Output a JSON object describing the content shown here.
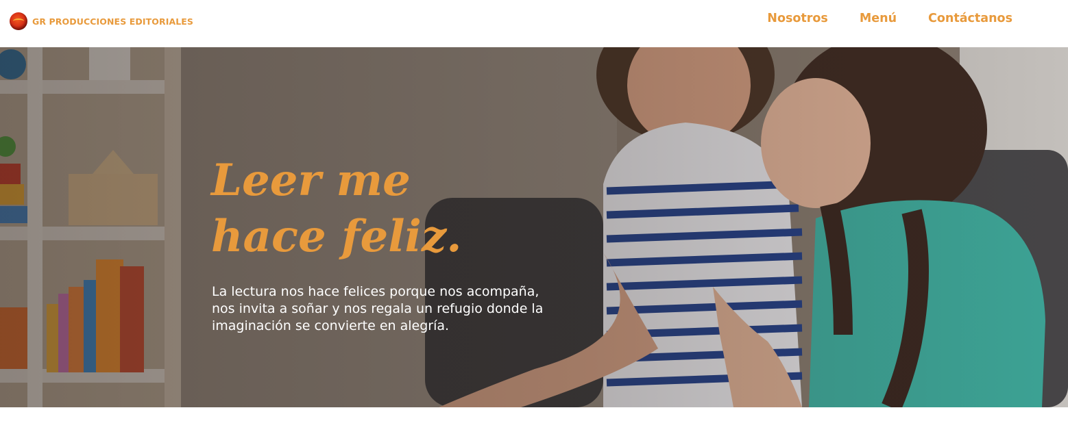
{
  "header": {
    "brand": "GR PRODUCCIONES EDITORIALES",
    "logo_icon": "book-logo-icon",
    "nav": [
      {
        "label": "Nosotros"
      },
      {
        "label": "Menú"
      },
      {
        "label": "Contáctanos"
      }
    ]
  },
  "hero": {
    "title_line1": "Leer me",
    "title_line2": "hace feliz.",
    "description": "La lectura nos hace felices porque nos acompaña, nos invita a soñar y nos regala un refugio donde la imaginación se convierte en alegría.",
    "image": "mother-and-daughter-reading-photo"
  },
  "colors": {
    "accent": "#e89a3c",
    "hero_text": "#ffffff",
    "background": "#ffffff"
  }
}
